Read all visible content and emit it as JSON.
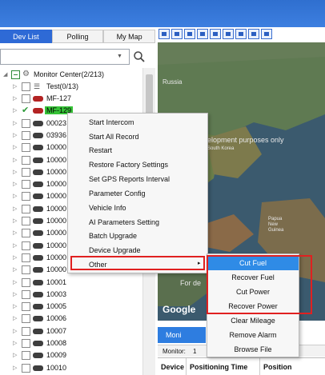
{
  "tabs": [
    {
      "label": "Dev List"
    },
    {
      "label": "Polling"
    },
    {
      "label": "My Map"
    }
  ],
  "search": {
    "value": "",
    "placeholder": ""
  },
  "tree": {
    "root_label": "Monitor Center(2/213)",
    "group_label": "Test(0/13)",
    "rows": [
      {
        "label": "MF-127"
      },
      {
        "label": "MF-129"
      },
      {
        "label": "00023"
      },
      {
        "label": "03936"
      },
      {
        "label": "10000"
      },
      {
        "label": "10000"
      },
      {
        "label": "10000"
      },
      {
        "label": "10000"
      },
      {
        "label": "10000"
      },
      {
        "label": "10000"
      },
      {
        "label": "10000"
      },
      {
        "label": "10000"
      },
      {
        "label": "10000"
      },
      {
        "label": "10000"
      },
      {
        "label": "10000"
      },
      {
        "label": "10001"
      },
      {
        "label": "10003"
      },
      {
        "label": "10005"
      },
      {
        "label": "10006"
      },
      {
        "label": "10007"
      },
      {
        "label": "10008"
      },
      {
        "label": "10009"
      },
      {
        "label": "10010"
      }
    ]
  },
  "map": {
    "labels": [
      "Russia",
      "elopment purposes only",
      "South Korea",
      "Papua New Guinea",
      "For de"
    ],
    "logo": "Google"
  },
  "monitor": {
    "tab_label": "Moni",
    "label": "Monitor:",
    "count": "1"
  },
  "table": {
    "headers": [
      "Device",
      "Positioning Time",
      "Position"
    ]
  },
  "context_menu": {
    "items": [
      "Start Intercom",
      "Start All Record",
      "Restart",
      "Restore Factory Settings",
      "Set GPS Reports Interval",
      "Parameter Config",
      "Vehicle Info",
      "AI Parameters Setting",
      "Batch Upgrade",
      "Device Upgrade",
      "Other"
    ],
    "arrow": "▸"
  },
  "submenu": {
    "items": [
      "Cut Fuel",
      "Recover Fuel",
      "Cut Power",
      "Recover Power",
      "Clear Mileage",
      "Remove Alarm",
      "Browse File"
    ]
  },
  "colors": {
    "accent": "#2e6ad6",
    "highlight": "#2f8be6",
    "annotation": "#e02020",
    "selected": "#36c337"
  }
}
